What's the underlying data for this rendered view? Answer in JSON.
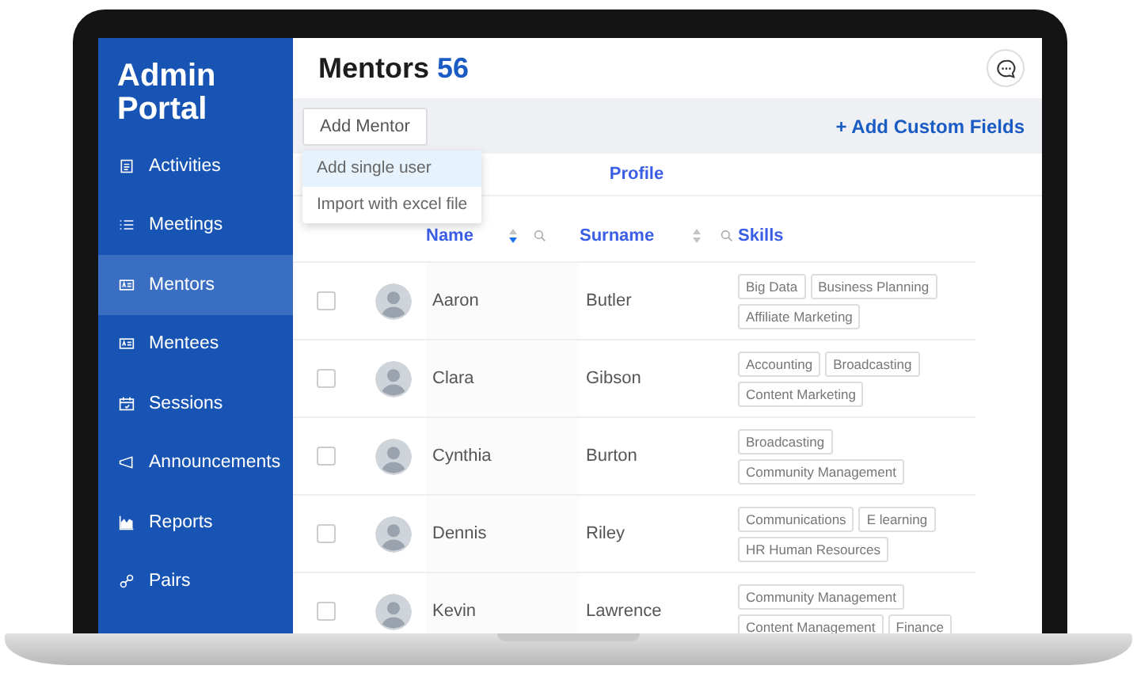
{
  "sidebar": {
    "title": "Admin Portal",
    "items": [
      {
        "label": "Activities",
        "selected": false
      },
      {
        "label": "Meetings",
        "selected": false
      },
      {
        "label": "Mentors",
        "selected": true
      },
      {
        "label": "Mentees",
        "selected": false
      },
      {
        "label": "Sessions",
        "selected": false
      },
      {
        "label": "Announcements",
        "selected": false
      },
      {
        "label": "Reports",
        "selected": false
      },
      {
        "label": "Pairs",
        "selected": false
      }
    ]
  },
  "header": {
    "title": "Mentors",
    "count": "56"
  },
  "toolbar": {
    "button": "Add Mentor",
    "link": "+ Add Custom Fields"
  },
  "dropdown": [
    {
      "label": "Add single user",
      "selected": true
    },
    {
      "label": "Import with excel file",
      "selected": false
    }
  ],
  "table": {
    "group": "Profile",
    "columns": [
      {
        "label": "Name",
        "kind": "sortable",
        "sorted": true
      },
      {
        "label": "Surname",
        "kind": "sortable",
        "sorted": false
      },
      {
        "label": "Skills",
        "kind": "plain"
      }
    ],
    "rows": [
      {
        "checked": false,
        "name": "Aaron",
        "surname": "Butler",
        "skills": [
          "Big Data",
          "Business Planning",
          "Affiliate Marketing"
        ]
      },
      {
        "checked": false,
        "name": "Clara",
        "surname": "Gibson",
        "skills": [
          "Accounting",
          "Broadcasting",
          "Content Marketing"
        ]
      },
      {
        "checked": false,
        "name": "Cynthia",
        "surname": "Burton",
        "skills": [
          "Broadcasting",
          "Community Management"
        ]
      },
      {
        "checked": false,
        "name": "Dennis",
        "surname": "Riley",
        "skills": [
          "Communications",
          "E learning",
          "HR Human Resources"
        ]
      },
      {
        "checked": false,
        "name": "Kevin",
        "surname": "Lawrence",
        "skills": [
          "Community Management",
          "Content Management",
          "Finance"
        ]
      }
    ]
  }
}
